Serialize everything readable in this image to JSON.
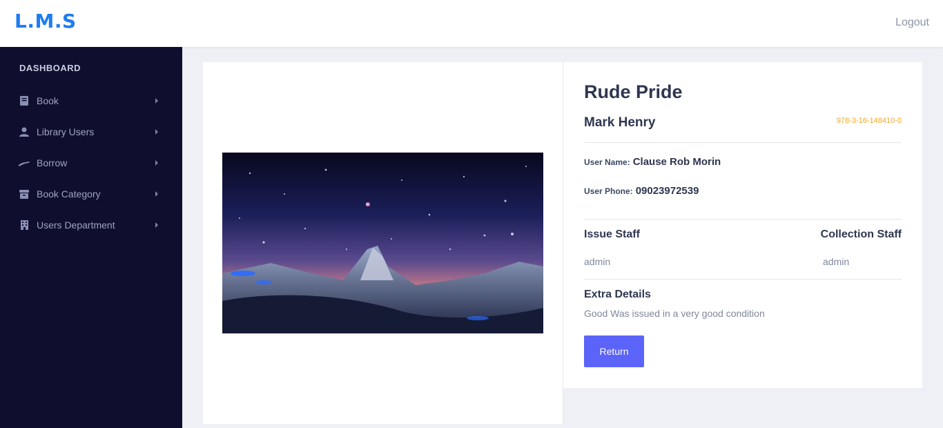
{
  "header": {
    "brand": "L.M.S",
    "logout_label": "Logout"
  },
  "sidebar": {
    "heading": "DASHBOARD",
    "items": [
      {
        "label": "Book",
        "icon": "book-icon"
      },
      {
        "label": "Library Users",
        "icon": "user-icon"
      },
      {
        "label": "Borrow",
        "icon": "hand-icon"
      },
      {
        "label": "Book Category",
        "icon": "box-icon"
      },
      {
        "label": "Users Department",
        "icon": "building-icon"
      }
    ]
  },
  "detail": {
    "title": "Rude Pride",
    "author": "Mark Henry",
    "isbn": "978-3-16-148410-0",
    "user_name_label": "User Name:",
    "user_name": "Clause Rob Morin",
    "user_phone_label": "User Phone:",
    "user_phone": "09023972539",
    "issue_staff_label": "Issue Staff",
    "issue_staff": "admin",
    "collection_staff_label": "Collection Staff",
    "collection_staff": "admin",
    "extra_label": "Extra Details",
    "extra_value": "Good Was issued in a very good condition",
    "return_label": "Return"
  },
  "colors": {
    "brand": "#1f7cf0",
    "sidebar_bg": "#0f0e2e",
    "accent_button": "#5b63f8",
    "isbn": "#f5a623"
  }
}
